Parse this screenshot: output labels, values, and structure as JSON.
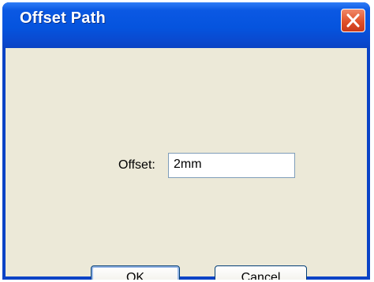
{
  "window": {
    "title": "Offset Path"
  },
  "form": {
    "offset_label": "Offset:",
    "offset_value": "2mm"
  },
  "buttons": {
    "ok_label": "OK",
    "cancel_label": "Cancel"
  },
  "icons": {
    "close": "close-icon"
  },
  "colors": {
    "titlebar": "#0554de",
    "close_button": "#e0512a",
    "client_background": "#ece9d8",
    "input_border": "#7f9db9",
    "button_border": "#003c74"
  }
}
